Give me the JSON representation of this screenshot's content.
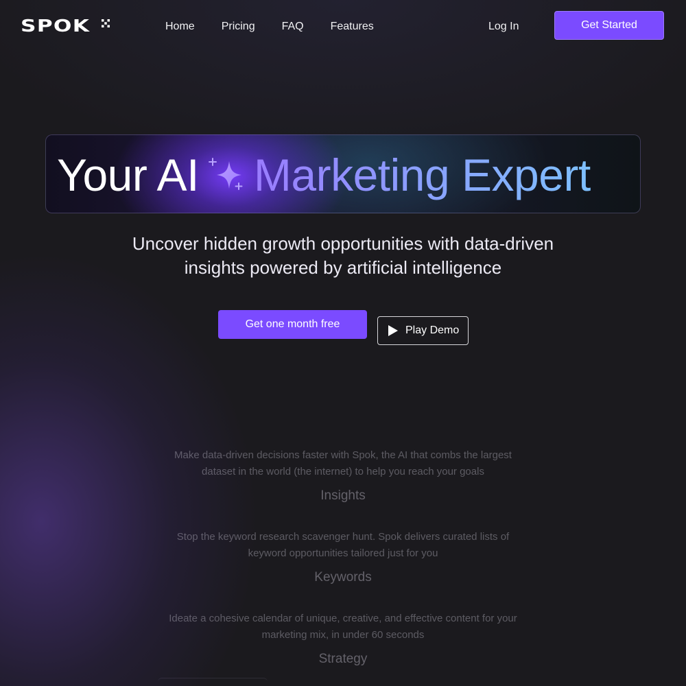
{
  "nav": {
    "logo": "SPOK",
    "links": [
      {
        "label": "Home"
      },
      {
        "label": "Pricing"
      },
      {
        "label": "FAQ"
      },
      {
        "label": "Features"
      }
    ],
    "login": "Log In",
    "get_started": "Get Started"
  },
  "hero": {
    "title_plain": "Your AI",
    "title_gradient": "Marketing Expert",
    "subtitle_line1": "Uncover hidden growth opportunities with data-driven",
    "subtitle_line2": "insights powered by artificial intelligence",
    "cta_primary": "Get one month free",
    "cta_secondary": "Play Demo"
  },
  "features": [
    {
      "description": "Make data-driven decisions faster with Spok, the AI that combs the largest dataset in the world (the internet) to help you reach your goals",
      "name": "Insights"
    },
    {
      "description": "Stop the keyword research scavenger hunt. Spok delivers curated lists of keyword opportunities tailored just for you",
      "name": "Keywords"
    },
    {
      "description": "Ideate a cohesive calendar of unique, creative, and effective content for your marketing mix, in under 60 seconds",
      "name": "Strategy"
    }
  ],
  "colors": {
    "accent": "#7b4bff",
    "background": "#1b1a1e",
    "gradient_start": "#9a7cff",
    "gradient_end": "#7ec0ff"
  },
  "icons": {
    "logo_mark": "asterisk-icon",
    "sparkle": "sparkle-icon",
    "play": "play-icon"
  }
}
